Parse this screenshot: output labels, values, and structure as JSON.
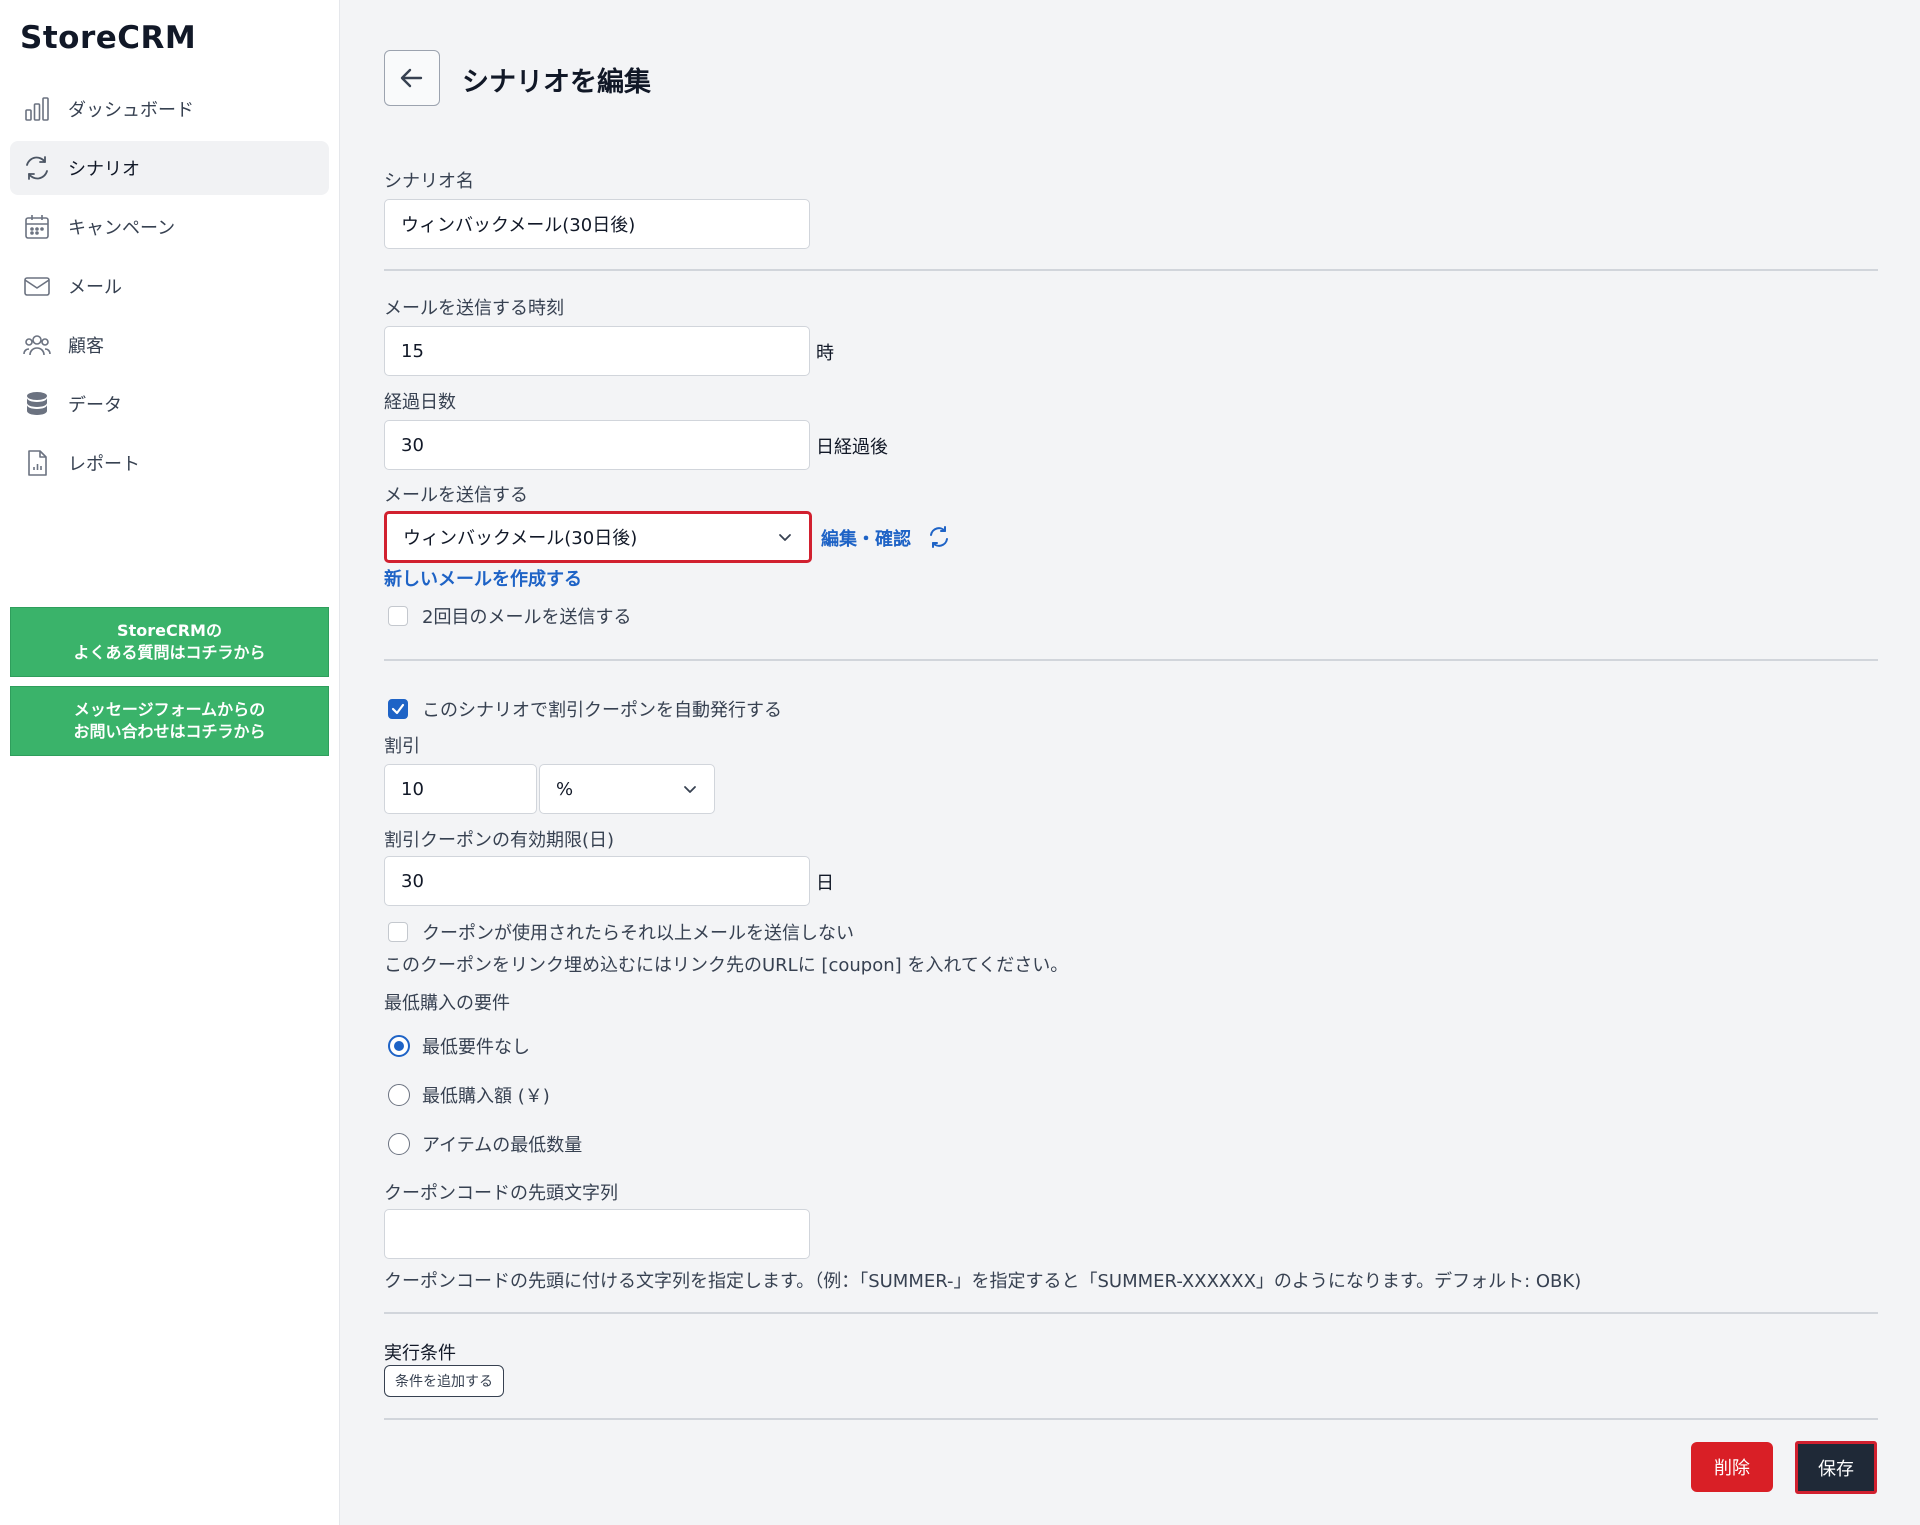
{
  "app": {
    "brand": "StoreCRM"
  },
  "sidebar": {
    "items": [
      {
        "label": "ダッシュボード",
        "icon": "bar-chart-icon"
      },
      {
        "label": "シナリオ",
        "icon": "refresh-icon",
        "active": true
      },
      {
        "label": "キャンペーン",
        "icon": "calendar-icon"
      },
      {
        "label": "メール",
        "icon": "mail-icon"
      },
      {
        "label": "顧客",
        "icon": "users-icon"
      },
      {
        "label": "データ",
        "icon": "database-icon"
      },
      {
        "label": "レポート",
        "icon": "report-icon"
      }
    ],
    "faq_line1": "StoreCRMの",
    "faq_line2": "よくある質問はコチラから",
    "contact_line1": "メッセージフォームからの",
    "contact_line2": "お問い合わせはコチラから",
    "help_color": "#3ab36a"
  },
  "page": {
    "title": "シナリオを編集"
  },
  "form": {
    "scenario_name_label": "シナリオ名",
    "scenario_name_value": "ウィンバックメール(30日後)",
    "send_time_label": "メールを送信する時刻",
    "send_time_value": "15",
    "send_time_suffix": "時",
    "days_label": "経過日数",
    "days_value": "30",
    "days_suffix": "日経過後",
    "email_label": "メールを送信する",
    "email_selected": "ウィンバックメール(30日後)",
    "edit_confirm_link": "編集・確認",
    "new_email_link": "新しいメールを作成する",
    "second_email_label": "2回目のメールを送信する",
    "second_email_checked": false,
    "coupon_auto_label": "このシナリオで割引クーポンを自動発行する",
    "coupon_auto_checked": true,
    "discount_label": "割引",
    "discount_value": "10",
    "discount_unit": "%",
    "expiry_label": "割引クーポンの有効期限(日)",
    "expiry_value": "30",
    "expiry_suffix": "日",
    "stop_if_used_label": "クーポンが使用されたらそれ以上メールを送信しない",
    "stop_if_used_checked": false,
    "coupon_link_help": "このクーポンをリンク埋め込むにはリンク先のURLに [coupon] を入れてください。",
    "min_req_label": "最低購入の要件",
    "min_req_options": [
      "最低要件なし",
      "最低購入額 (￥)",
      "アイテムの最低数量"
    ],
    "min_req_selected": 0,
    "prefix_label": "クーポンコードの先頭文字列",
    "prefix_value": "",
    "prefix_help": "クーポンコードの先頭に付ける文字列を指定します。（例：「SUMMER-」を指定すると「SUMMER-XXXXXX」のようになります。デフォルト: OBK)",
    "conditions_label": "実行条件",
    "add_condition_button": "条件を追加する"
  },
  "actions": {
    "delete_label": "削除",
    "save_label": "保存",
    "delete_color": "#d91f26",
    "save_color": "#1f2937",
    "highlight_color": "#d1202f",
    "link_color": "#1e63c6"
  }
}
